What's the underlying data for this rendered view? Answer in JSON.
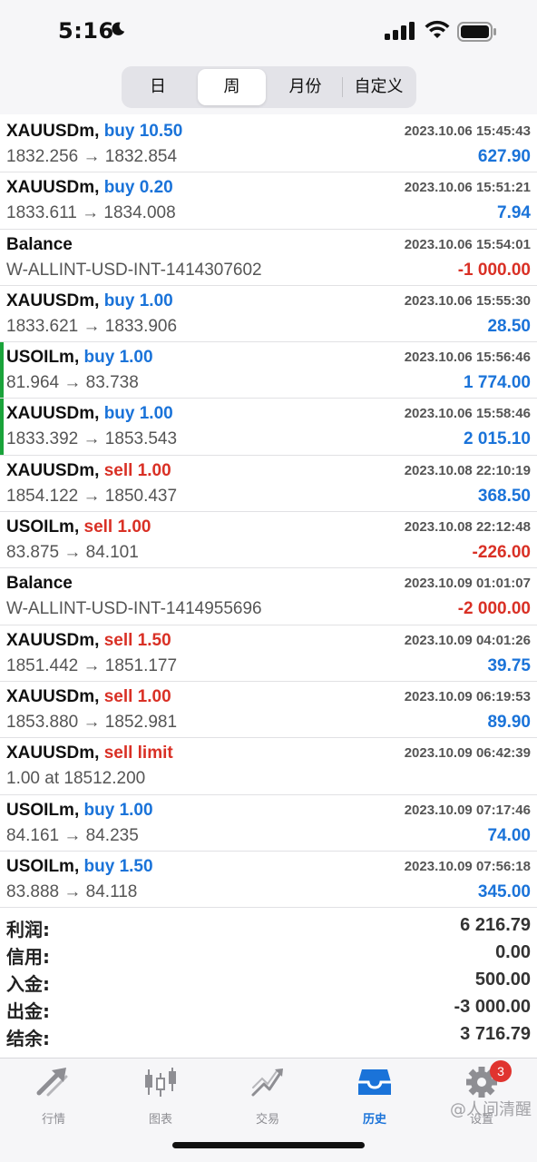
{
  "status_bar": {
    "time": "5:16"
  },
  "period_tabs": [
    {
      "label": "日",
      "active": false
    },
    {
      "label": "周",
      "active": true
    },
    {
      "label": "月份",
      "active": false
    },
    {
      "label": "自定义",
      "active": false
    }
  ],
  "deals": [
    {
      "symbol": "XAUUSDm,",
      "action": "buy 10.50",
      "side": "buy",
      "time": "2023.10.06 15:45:43",
      "detail": "1832.256 → 1832.854",
      "profit": "627.90",
      "sign": "pos",
      "marker": false
    },
    {
      "symbol": "XAUUSDm,",
      "action": "buy 0.20",
      "side": "buy",
      "time": "2023.10.06 15:51:21",
      "detail": "1833.611 → 1834.008",
      "profit": "7.94",
      "sign": "pos",
      "marker": false
    },
    {
      "symbol": "Balance",
      "action": "",
      "side": "none",
      "time": "2023.10.06 15:54:01",
      "detail": "W-ALLINT-USD-INT-1414307602",
      "profit": "-1 000.00",
      "sign": "neg",
      "marker": false
    },
    {
      "symbol": "XAUUSDm,",
      "action": "buy 1.00",
      "side": "buy",
      "time": "2023.10.06 15:55:30",
      "detail": "1833.621 → 1833.906",
      "profit": "28.50",
      "sign": "pos",
      "marker": false
    },
    {
      "symbol": "USOILm,",
      "action": "buy 1.00",
      "side": "buy",
      "time": "2023.10.06 15:56:46",
      "detail": "81.964 → 83.738",
      "profit": "1 774.00",
      "sign": "pos",
      "marker": true
    },
    {
      "symbol": "XAUUSDm,",
      "action": "buy 1.00",
      "side": "buy",
      "time": "2023.10.06 15:58:46",
      "detail": "1833.392 → 1853.543",
      "profit": "2 015.10",
      "sign": "pos",
      "marker": true
    },
    {
      "symbol": "XAUUSDm,",
      "action": "sell 1.00",
      "side": "sell",
      "time": "2023.10.08 22:10:19",
      "detail": "1854.122 → 1850.437",
      "profit": "368.50",
      "sign": "pos",
      "marker": false
    },
    {
      "symbol": "USOILm,",
      "action": "sell 1.00",
      "side": "sell",
      "time": "2023.10.08 22:12:48",
      "detail": "83.875 → 84.101",
      "profit": "-226.00",
      "sign": "neg",
      "marker": false
    },
    {
      "symbol": "Balance",
      "action": "",
      "side": "none",
      "time": "2023.10.09 01:01:07",
      "detail": "W-ALLINT-USD-INT-1414955696",
      "profit": "-2 000.00",
      "sign": "neg",
      "marker": false
    },
    {
      "symbol": "XAUUSDm,",
      "action": "sell 1.50",
      "side": "sell",
      "time": "2023.10.09 04:01:26",
      "detail": "1851.442 → 1851.177",
      "profit": "39.75",
      "sign": "pos",
      "marker": false
    },
    {
      "symbol": "XAUUSDm,",
      "action": "sell 1.00",
      "side": "sell",
      "time": "2023.10.09 06:19:53",
      "detail": "1853.880 → 1852.981",
      "profit": "89.90",
      "sign": "pos",
      "marker": false
    },
    {
      "symbol": "XAUUSDm,",
      "action": "sell limit",
      "side": "sell",
      "time": "2023.10.09 06:42:39",
      "detail": "1.00 at 18512.200",
      "profit": "",
      "sign": "pos",
      "marker": false
    },
    {
      "symbol": "USOILm,",
      "action": "buy 1.00",
      "side": "buy",
      "time": "2023.10.09 07:17:46",
      "detail": "84.161 → 84.235",
      "profit": "74.00",
      "sign": "pos",
      "marker": false
    },
    {
      "symbol": "USOILm,",
      "action": "buy 1.50",
      "side": "buy",
      "time": "2023.10.09 07:56:18",
      "detail": "83.888 → 84.118",
      "profit": "345.00",
      "sign": "pos",
      "marker": false
    }
  ],
  "summary": [
    {
      "label": "利润:",
      "value": "6 216.79"
    },
    {
      "label": "信用:",
      "value": "0.00"
    },
    {
      "label": "入金:",
      "value": "500.00"
    },
    {
      "label": "出金:",
      "value": "-3 000.00"
    },
    {
      "label": "结余:",
      "value": "3 716.79"
    }
  ],
  "tab_bar": [
    {
      "label": "行情",
      "icon": "quotes-arrow-icon",
      "active": false
    },
    {
      "label": "图表",
      "icon": "candlestick-icon",
      "active": false
    },
    {
      "label": "交易",
      "icon": "trade-trend-icon",
      "active": false
    },
    {
      "label": "历史",
      "icon": "history-inbox-icon",
      "active": true
    },
    {
      "label": "设置",
      "icon": "gear-icon",
      "active": false,
      "badge": "3"
    }
  ],
  "watermark": "@人间清醒",
  "colors": {
    "buy": "#1a73d9",
    "sell": "#d93025",
    "marker": "#1aa33a",
    "active_tab": "#1a73d9"
  }
}
